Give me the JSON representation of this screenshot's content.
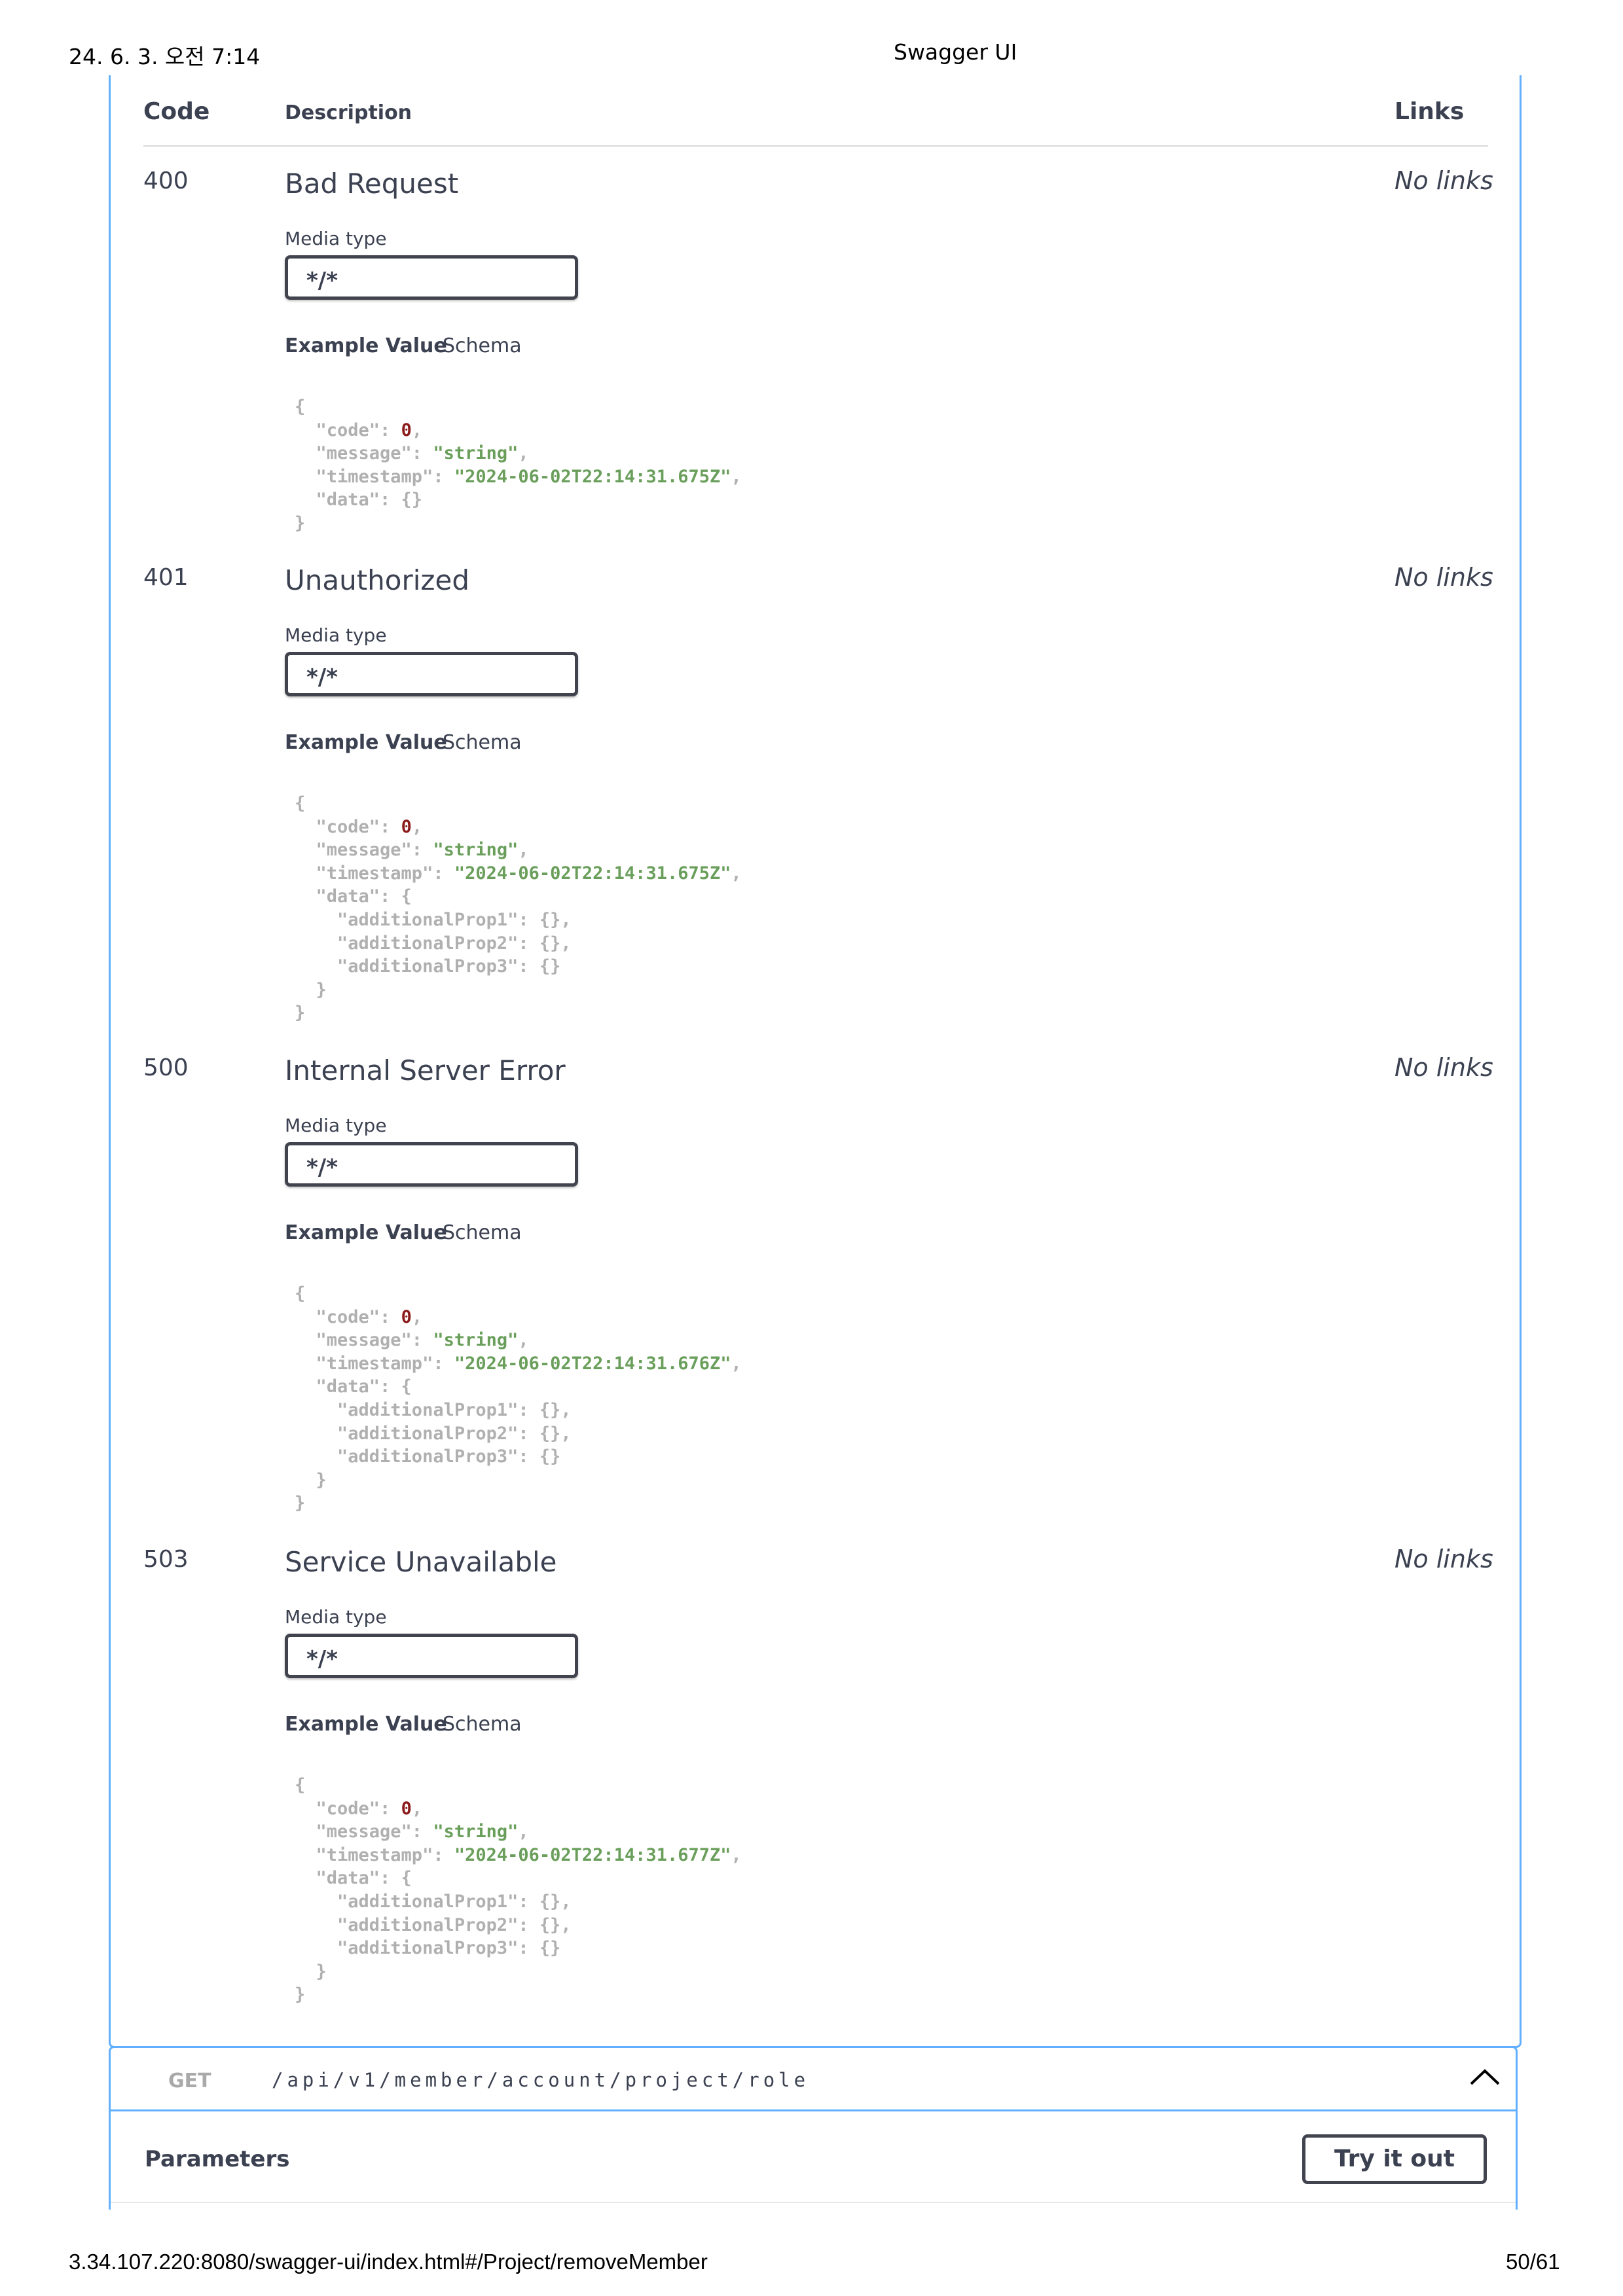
{
  "print_header": {
    "datetime": "24. 6. 3. 오전 7:14",
    "title": "Swagger UI"
  },
  "print_footer": {
    "url": "3.34.107.220:8080/swagger-ui/index.html#/Project/removeMember",
    "page": "50/61"
  },
  "table": {
    "col_code": "Code",
    "col_description": "Description",
    "col_links": "Links"
  },
  "responses": [
    {
      "code": "400",
      "description": "Bad Request",
      "links": "No links",
      "media_type_label": "Media type",
      "media_type": "*/*",
      "tab_example": "Example Value",
      "tab_schema": "Schema",
      "example": {
        "code": "0",
        "message": "\"string\"",
        "timestamp": "\"2024-06-02T22:14:31.675Z\""
      }
    },
    {
      "code": "401",
      "description": "Unauthorized",
      "links": "No links",
      "media_type_label": "Media type",
      "media_type": "*/*",
      "tab_example": "Example Value",
      "tab_schema": "Schema",
      "example": {
        "code": "0",
        "message": "\"string\"",
        "timestamp": "\"2024-06-02T22:14:31.675Z\""
      }
    },
    {
      "code": "500",
      "description": "Internal Server Error",
      "links": "No links",
      "media_type_label": "Media type",
      "media_type": "*/*",
      "tab_example": "Example Value",
      "tab_schema": "Schema",
      "example": {
        "code": "0",
        "message": "\"string\"",
        "timestamp": "\"2024-06-02T22:14:31.676Z\""
      }
    },
    {
      "code": "503",
      "description": "Service Unavailable",
      "links": "No links",
      "media_type_label": "Media type",
      "media_type": "*/*",
      "tab_example": "Example Value",
      "tab_schema": "Schema",
      "example": {
        "code": "0",
        "message": "\"string\"",
        "timestamp": "\"2024-06-02T22:14:31.677Z\""
      }
    }
  ],
  "next_operation": {
    "method": "GET",
    "path": "/api/v1/member/account/project/role",
    "collapse_icon": "chevron-up-icon",
    "parameters_title": "Parameters",
    "try_button": "Try it out"
  },
  "colors": {
    "accent_border": "#61affe",
    "json_string": "#6a9f5b",
    "json_number": "#8b1a1a",
    "json_punct": "#b0b0b0"
  }
}
